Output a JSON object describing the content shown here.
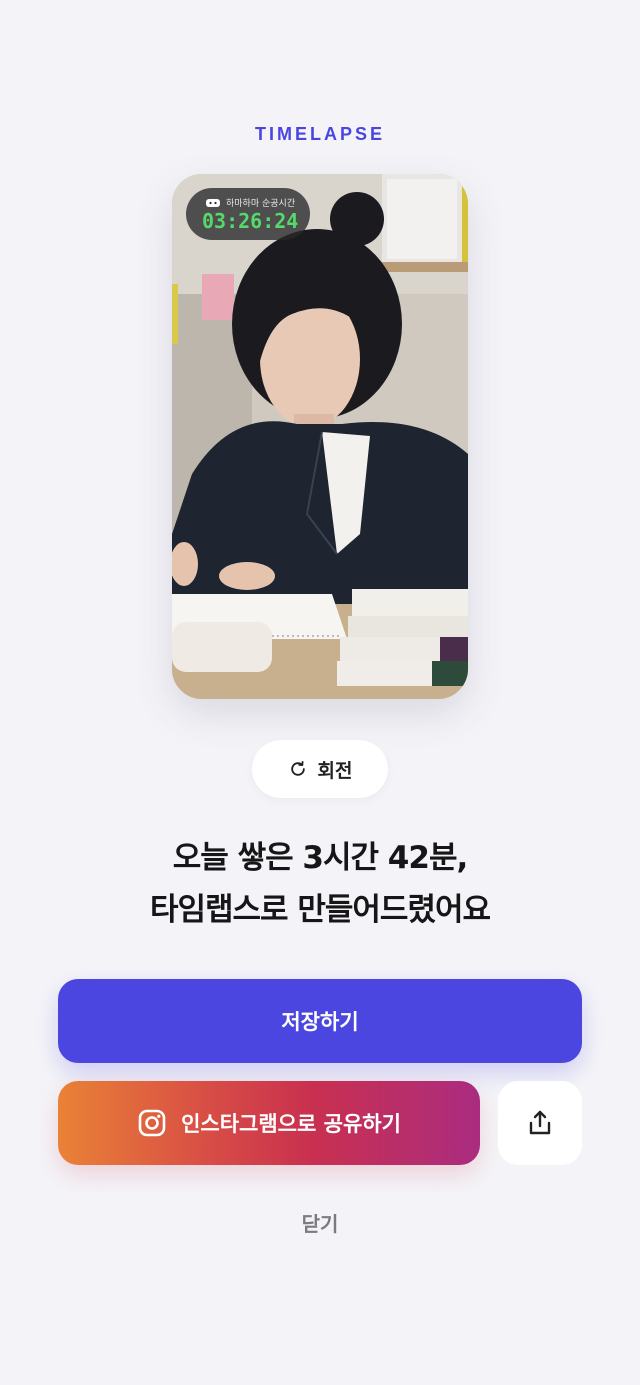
{
  "header": {
    "eyebrow": "TIMELAPSE"
  },
  "preview": {
    "timer_label": "하마하마 순공시간",
    "timer_value": "03:26:24"
  },
  "rotate_button": {
    "label": "회전",
    "icon": "rotate-icon"
  },
  "headline": {
    "line1": "오늘 쌓은 3시간 42분,",
    "line2": "타임랩스로 만들어드렸어요"
  },
  "actions": {
    "save_label": "저장하기",
    "instagram_label": "인스타그램으로 공유하기",
    "instagram_icon": "instagram-icon",
    "share_icon": "share-icon",
    "close_label": "닫기"
  },
  "colors": {
    "accent": "#4b46df",
    "timer_text": "#56d96a",
    "instagram_gradient_start": "#e98236",
    "instagram_gradient_end": "#aa2c80"
  }
}
